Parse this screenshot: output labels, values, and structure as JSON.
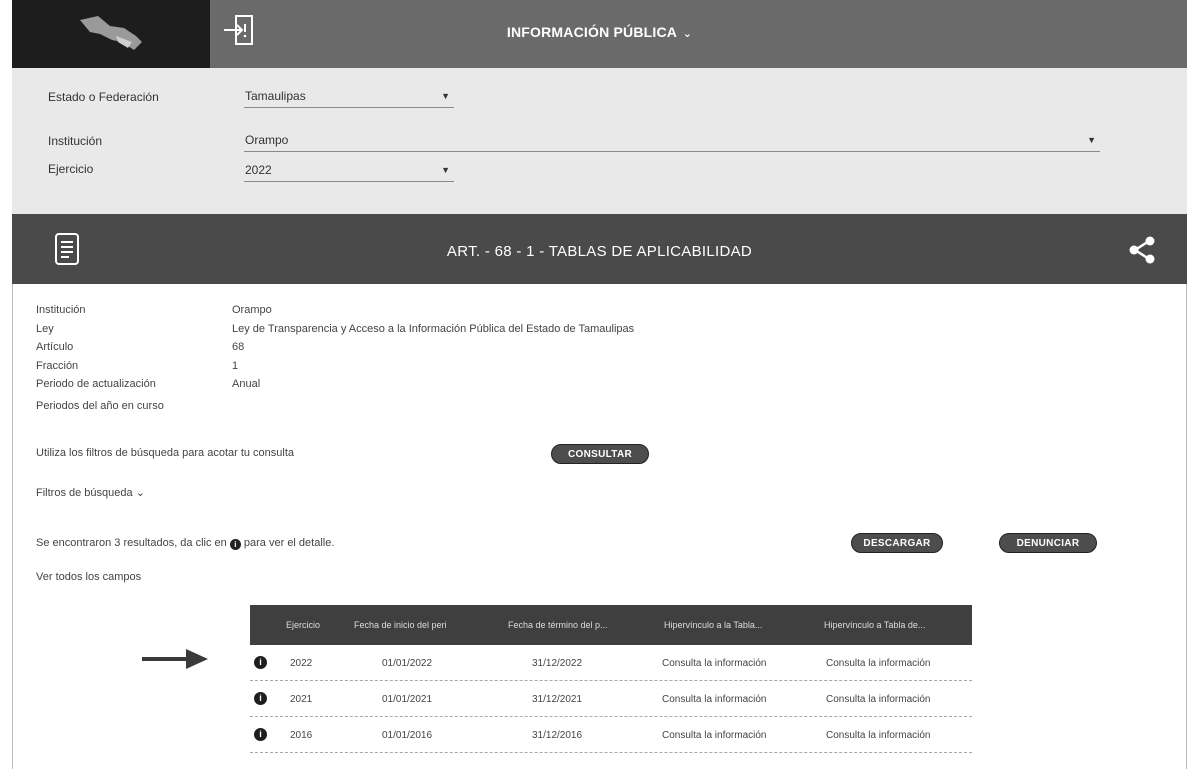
{
  "topbar": {
    "title": "INFORMACIÓN PÚBLICA",
    "title_chevron": "⌄"
  },
  "filters": {
    "estado_label": "Estado o Federación",
    "estado_value": "Tamaulipas",
    "institucion_label": "Institución",
    "institucion_value": "Orampo",
    "ejercicio_label": "Ejercicio",
    "ejercicio_value": "2022"
  },
  "section": {
    "title": "ART. - 68 - 1 - TABLAS DE APLICABILIDAD"
  },
  "detail": {
    "rows": [
      {
        "label": "Institución",
        "value": "Orampo"
      },
      {
        "label": "Ley",
        "value": "Ley de Transparencia y Acceso a la Información Pública del Estado de Tamaulipas"
      },
      {
        "label": "Artículo",
        "value": "68"
      },
      {
        "label": "Fracción",
        "value": "1"
      },
      {
        "label": "Periodo de actualización",
        "value": "Anual"
      }
    ],
    "note": "Periodos del año en curso",
    "help_text": "Utiliza los filtros de búsqueda para acotar tu consulta",
    "consultar_label": "CONSULTAR",
    "filtros_label": "Filtros de búsqueda",
    "filtros_chevron": "⌄",
    "results_text_before": "Se encontraron 3 resultados, da clic en",
    "results_text_after": "para ver el detalle.",
    "descargar_label": "DESCARGAR",
    "denunciar_label": "DENUNCIAR",
    "ver_campos_label": "Ver todos los campos"
  },
  "table": {
    "headers": [
      "Ejercicio",
      "Fecha de inicio del peri",
      "Fecha de término del p...",
      "Hipervínculo a la Tabla...",
      "Hipervínculo a Tabla de..."
    ],
    "rows": [
      {
        "ejercicio": "2022",
        "inicio": "01/01/2022",
        "termino": "31/12/2022",
        "hip1": "Consulta la información",
        "hip2": "Consulta la información"
      },
      {
        "ejercicio": "2021",
        "inicio": "01/01/2021",
        "termino": "31/12/2021",
        "hip1": "Consulta la información",
        "hip2": "Consulta la información"
      },
      {
        "ejercicio": "2016",
        "inicio": "01/01/2016",
        "termino": "31/12/2016",
        "hip1": "Consulta la información",
        "hip2": "Consulta la información"
      }
    ]
  },
  "colors": {
    "topbar": "#6a6a6a",
    "logo_bg": "#1d1d1d",
    "filters_bg": "#e9e9e9",
    "section_bg": "#4a4a4a",
    "table_head": "#3f3f3f",
    "pill": "#4d4d4d"
  },
  "icons": {
    "logo": "logo-icon",
    "login": "login-icon",
    "document": "document-icon",
    "share": "share-icon",
    "info": "info-icon",
    "arrow": "arrow-right-icon"
  }
}
